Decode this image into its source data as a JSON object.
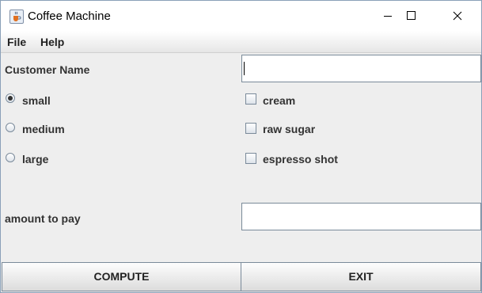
{
  "window": {
    "title": "Coffee Machine",
    "app_icon": "java-coffee-cup-icon",
    "controls": [
      "minimize-icon",
      "maximize-icon",
      "close-icon"
    ]
  },
  "menu": {
    "file": "File",
    "help": "Help"
  },
  "form": {
    "customer_name_label": "Customer Name",
    "customer_name_value": "",
    "sizes": [
      {
        "label": "small",
        "selected": true
      },
      {
        "label": "medium",
        "selected": false
      },
      {
        "label": "large",
        "selected": false
      }
    ],
    "extras": [
      {
        "label": "cream",
        "checked": false
      },
      {
        "label": "raw sugar",
        "checked": false
      },
      {
        "label": "espresso shot",
        "checked": false
      }
    ],
    "amount_label": "amount to pay",
    "amount_value": ""
  },
  "buttons": {
    "compute": "COMPUTE",
    "exit": "EXIT"
  }
}
